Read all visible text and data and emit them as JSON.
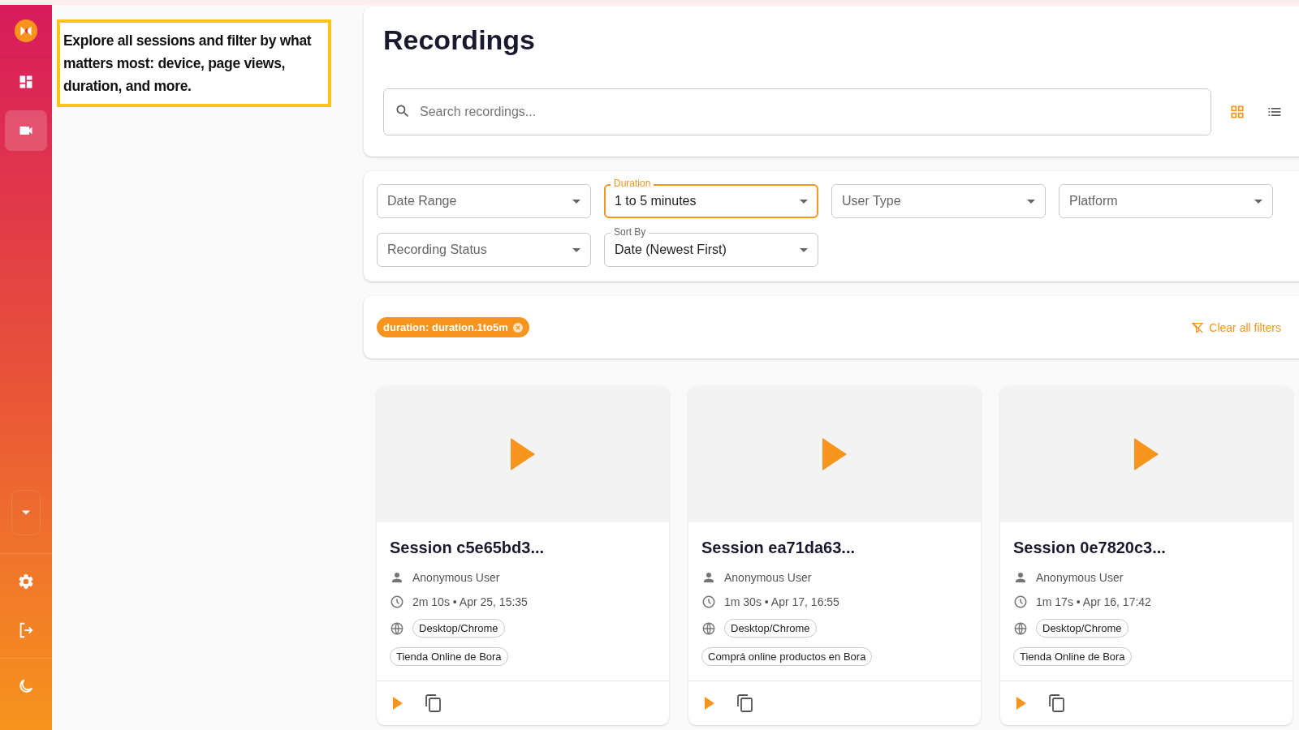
{
  "sidebar": {
    "items": [
      {
        "selected": false
      },
      {
        "selected": true
      }
    ]
  },
  "annotation": "Explore all sessions and filter by what matters most: device, page views, duration, and more.",
  "title": "Recordings",
  "search": {
    "placeholder": "Search recordings..."
  },
  "view_toggle": [
    {
      "selected": true
    },
    {
      "selected": false
    }
  ],
  "filters": [
    {
      "placeholder": "Date Range",
      "focused": false
    },
    {
      "label": "Duration",
      "value": "1 to 5 minutes",
      "focused": true
    },
    {
      "placeholder": "User Type",
      "focused": false
    },
    {
      "placeholder": "Platform",
      "focused": false
    },
    {
      "placeholder": "Recording Status",
      "focused": false
    },
    {
      "label": "Sort By",
      "value": "Date (Newest First)",
      "focused": false
    }
  ],
  "active_filters": [
    {
      "label": "duration: duration.1to5m"
    }
  ],
  "clear_filters": "Clear all filters",
  "cards": [
    {
      "title": "Session c5e65bd3...",
      "user": "Anonymous User",
      "meta": "2m 10s • Apr 25, 15:35",
      "device": "Desktop/Chrome",
      "site": "Tienda Online de Bora"
    },
    {
      "title": "Session ea71da63...",
      "user": "Anonymous User",
      "meta": "1m 30s • Apr 17, 16:55",
      "device": "Desktop/Chrome",
      "site": "Comprá online productos en Bora"
    },
    {
      "title": "Session 0e7820c3...",
      "user": "Anonymous User",
      "meta": "1m 17s • Apr 16, 17:42",
      "device": "Desktop/Chrome",
      "site": "Tienda Online de Bora"
    }
  ]
}
